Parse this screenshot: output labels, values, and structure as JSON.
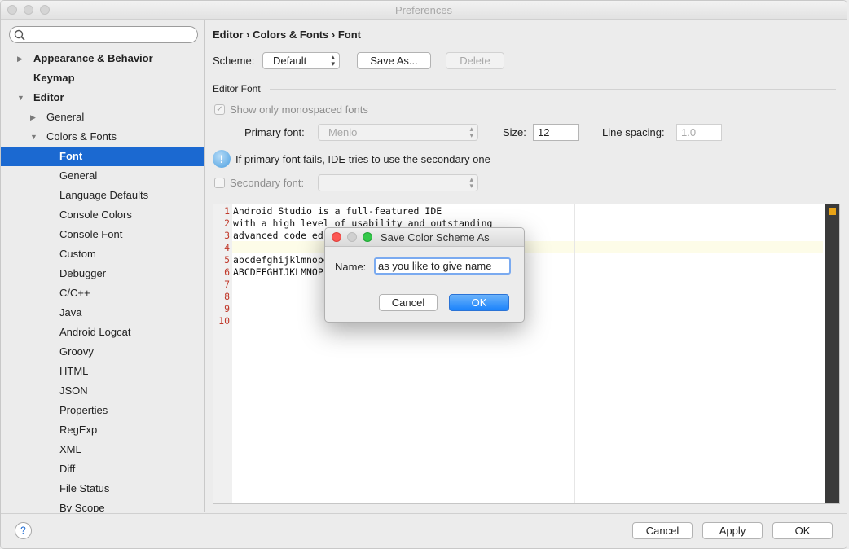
{
  "window": {
    "title": "Preferences"
  },
  "sidebar": {
    "search_placeholder": "",
    "items": [
      {
        "label": "Appearance & Behavior",
        "level": 0,
        "arrow": "▶",
        "bold": true,
        "selected": false
      },
      {
        "label": "Keymap",
        "level": 0,
        "arrow": "",
        "bold": true,
        "selected": false
      },
      {
        "label": "Editor",
        "level": 0,
        "arrow": "▼",
        "bold": true,
        "selected": false
      },
      {
        "label": "General",
        "level": 1,
        "arrow": "▶",
        "bold": false,
        "selected": false
      },
      {
        "label": "Colors & Fonts",
        "level": 1,
        "arrow": "▼",
        "bold": false,
        "selected": false
      },
      {
        "label": "Font",
        "level": 2,
        "arrow": "",
        "bold": false,
        "selected": true
      },
      {
        "label": "General",
        "level": 2,
        "arrow": "",
        "bold": false,
        "selected": false
      },
      {
        "label": "Language Defaults",
        "level": 2,
        "arrow": "",
        "bold": false,
        "selected": false
      },
      {
        "label": "Console Colors",
        "level": 2,
        "arrow": "",
        "bold": false,
        "selected": false
      },
      {
        "label": "Console Font",
        "level": 2,
        "arrow": "",
        "bold": false,
        "selected": false
      },
      {
        "label": "Custom",
        "level": 2,
        "arrow": "",
        "bold": false,
        "selected": false
      },
      {
        "label": "Debugger",
        "level": 2,
        "arrow": "",
        "bold": false,
        "selected": false
      },
      {
        "label": "C/C++",
        "level": 2,
        "arrow": "",
        "bold": false,
        "selected": false
      },
      {
        "label": "Java",
        "level": 2,
        "arrow": "",
        "bold": false,
        "selected": false
      },
      {
        "label": "Android Logcat",
        "level": 2,
        "arrow": "",
        "bold": false,
        "selected": false
      },
      {
        "label": "Groovy",
        "level": 2,
        "arrow": "",
        "bold": false,
        "selected": false
      },
      {
        "label": "HTML",
        "level": 2,
        "arrow": "",
        "bold": false,
        "selected": false
      },
      {
        "label": "JSON",
        "level": 2,
        "arrow": "",
        "bold": false,
        "selected": false
      },
      {
        "label": "Properties",
        "level": 2,
        "arrow": "",
        "bold": false,
        "selected": false
      },
      {
        "label": "RegExp",
        "level": 2,
        "arrow": "",
        "bold": false,
        "selected": false
      },
      {
        "label": "XML",
        "level": 2,
        "arrow": "",
        "bold": false,
        "selected": false
      },
      {
        "label": "Diff",
        "level": 2,
        "arrow": "",
        "bold": false,
        "selected": false
      },
      {
        "label": "File Status",
        "level": 2,
        "arrow": "",
        "bold": false,
        "selected": false
      },
      {
        "label": "By Scope",
        "level": 2,
        "arrow": "",
        "bold": false,
        "selected": false
      }
    ]
  },
  "main": {
    "breadcrumb": "Editor › Colors & Fonts › Font",
    "scheme_label": "Scheme:",
    "scheme_value": "Default",
    "save_as_label": "Save As...",
    "delete_label": "Delete",
    "section_title": "Editor Font",
    "show_mono_label": "Show only monospaced fonts",
    "primary_font_label": "Primary font:",
    "primary_font_value": "Menlo",
    "size_label": "Size:",
    "size_value": "12",
    "line_spacing_label": "Line spacing:",
    "line_spacing_value": "1.0",
    "info_text": "If primary font fails, IDE tries to use the secondary one",
    "secondary_font_label": "Secondary font:",
    "secondary_font_value": ""
  },
  "preview": {
    "lines": [
      {
        "num": "1",
        "text": "Android Studio is a full-featured IDE"
      },
      {
        "num": "2",
        "text": "with a high level of usability and outstanding"
      },
      {
        "num": "3",
        "text": "advanced code ed"
      },
      {
        "num": "4",
        "text": ""
      },
      {
        "num": "5",
        "text": "abcdefghijklmnope"
      },
      {
        "num": "6",
        "text": "ABCDEFGHIJKLMNOP"
      },
      {
        "num": "7",
        "text": ""
      },
      {
        "num": "8",
        "text": ""
      },
      {
        "num": "9",
        "text": ""
      },
      {
        "num": "10",
        "text": ""
      }
    ]
  },
  "dialog": {
    "title": "Save Color Scheme As",
    "name_label": "Name:",
    "name_value": "as you like to give name",
    "cancel_label": "Cancel",
    "ok_label": "OK"
  },
  "footer": {
    "help_label": "?",
    "cancel_label": "Cancel",
    "apply_label": "Apply",
    "ok_label": "OK"
  },
  "colors": {
    "selection": "#1b69d1",
    "primary_button": "#1a82fb",
    "line_numbers": "#c0392b",
    "marker": "#e8a317"
  }
}
